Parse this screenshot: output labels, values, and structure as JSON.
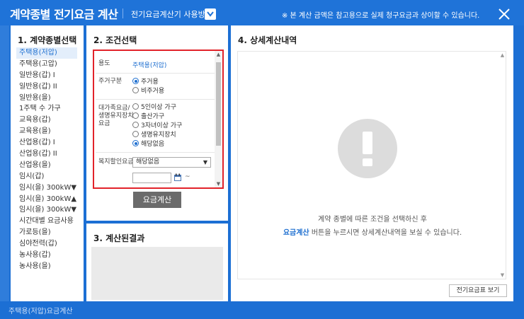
{
  "window": {
    "title": "계약종별 전기요금 계산",
    "howto_label": "전기요금계산기 사용방법",
    "notice": "※ 본 계산 금액은 참고용으로 실제 청구요금과 상이할 수 있습니다."
  },
  "panel1": {
    "heading": "1. 계약종별선택",
    "items": [
      "주택용(저압)",
      "주택용(고압)",
      "일반용(갑) I",
      "일반용(갑) II",
      "일반용(을)",
      "1주택 수 가구",
      "교육용(갑)",
      "교육용(을)",
      "산업용(갑) I",
      "산업용(갑) II",
      "산업용(을)",
      "임시(갑)",
      "임시(을) 300kW▼",
      "임시(을) 300kW▲",
      "임시(을) 300kW▼",
      "시간대별 요금사용",
      "가로등(을)",
      "심야전력(갑)",
      "농사용(갑)",
      "농사용(을)"
    ],
    "selected_index": 0
  },
  "panel2": {
    "heading": "2. 조건선택",
    "usage_label": "용도",
    "usage_value": "주택용(저압)",
    "residence_label": "주거구분",
    "residence_options": [
      "주거용",
      "비주거용"
    ],
    "residence_selected": "주거용",
    "family_label": "대가족요금/\n생명유지장치\n요금",
    "family_options": [
      "5인이상 가구",
      "출산가구",
      "3자녀이상 가구",
      "생명유지장치",
      "해당없음"
    ],
    "family_selected": "해당없음",
    "welfare_label": "복지할인요금",
    "welfare_value": "해당없음",
    "date_separator": "~",
    "calc_button": "요금계산"
  },
  "panel3": {
    "heading": "3. 계산된결과"
  },
  "panel4": {
    "heading": "4. 상세계산내역",
    "message_line1": "계약 종별에 따른 조건을 선택하신 후",
    "message_highlight": "요금계산",
    "message_line2_rest": " 버튼을 누르시면 상세계산내역을 보실 수 있습니다.",
    "table_button": "전기요금표 보기"
  },
  "footer": {
    "text": "주택용(저압)요금계산"
  },
  "colors": {
    "brand": "#1f73d8",
    "highlight": "#1e6fd0",
    "frame": "#e2232a"
  }
}
